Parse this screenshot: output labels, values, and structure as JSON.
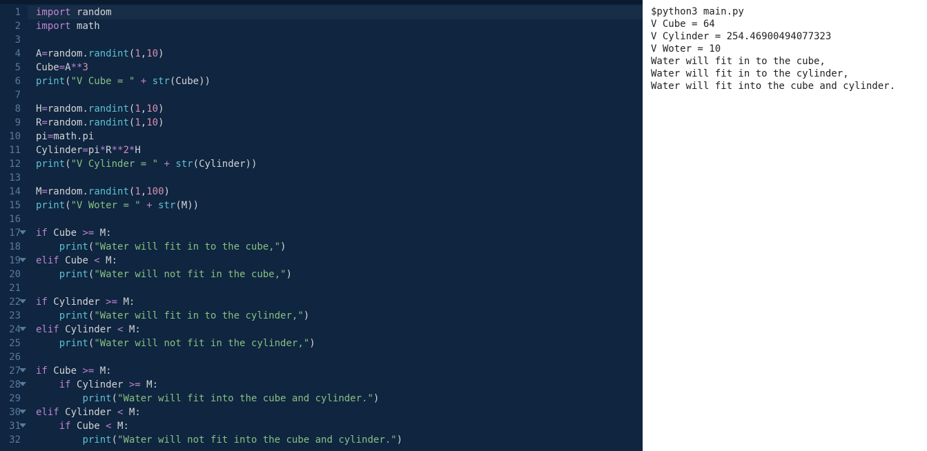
{
  "editor": {
    "lines": [
      {
        "n": 1,
        "fold": false,
        "tokens": [
          {
            "t": "import ",
            "c": "kw"
          },
          {
            "t": "random",
            "c": "name"
          }
        ]
      },
      {
        "n": 2,
        "fold": false,
        "tokens": [
          {
            "t": "import ",
            "c": "kw"
          },
          {
            "t": "math",
            "c": "name"
          }
        ]
      },
      {
        "n": 3,
        "fold": false,
        "tokens": []
      },
      {
        "n": 4,
        "fold": false,
        "tokens": [
          {
            "t": "A",
            "c": "name"
          },
          {
            "t": "=",
            "c": "op"
          },
          {
            "t": "random",
            "c": "name"
          },
          {
            "t": ".",
            "c": "punct"
          },
          {
            "t": "randint",
            "c": "func"
          },
          {
            "t": "(",
            "c": "punct"
          },
          {
            "t": "1",
            "c": "num"
          },
          {
            "t": ",",
            "c": "punct"
          },
          {
            "t": "10",
            "c": "num"
          },
          {
            "t": ")",
            "c": "punct"
          }
        ]
      },
      {
        "n": 5,
        "fold": false,
        "tokens": [
          {
            "t": "Cube",
            "c": "name"
          },
          {
            "t": "=",
            "c": "op"
          },
          {
            "t": "A",
            "c": "name"
          },
          {
            "t": "**",
            "c": "op"
          },
          {
            "t": "3",
            "c": "num"
          }
        ]
      },
      {
        "n": 6,
        "fold": false,
        "tokens": [
          {
            "t": "print",
            "c": "builtin"
          },
          {
            "t": "(",
            "c": "punct"
          },
          {
            "t": "\"V Cube = \"",
            "c": "str"
          },
          {
            "t": " + ",
            "c": "op"
          },
          {
            "t": "str",
            "c": "builtin"
          },
          {
            "t": "(",
            "c": "punct"
          },
          {
            "t": "Cube",
            "c": "name"
          },
          {
            "t": ")",
            "c": "punct"
          },
          {
            "t": ")",
            "c": "punct"
          }
        ]
      },
      {
        "n": 7,
        "fold": false,
        "tokens": []
      },
      {
        "n": 8,
        "fold": false,
        "tokens": [
          {
            "t": "H",
            "c": "name"
          },
          {
            "t": "=",
            "c": "op"
          },
          {
            "t": "random",
            "c": "name"
          },
          {
            "t": ".",
            "c": "punct"
          },
          {
            "t": "randint",
            "c": "func"
          },
          {
            "t": "(",
            "c": "punct"
          },
          {
            "t": "1",
            "c": "num"
          },
          {
            "t": ",",
            "c": "punct"
          },
          {
            "t": "10",
            "c": "num"
          },
          {
            "t": ")",
            "c": "punct"
          }
        ]
      },
      {
        "n": 9,
        "fold": false,
        "tokens": [
          {
            "t": "R",
            "c": "name"
          },
          {
            "t": "=",
            "c": "op"
          },
          {
            "t": "random",
            "c": "name"
          },
          {
            "t": ".",
            "c": "punct"
          },
          {
            "t": "randint",
            "c": "func"
          },
          {
            "t": "(",
            "c": "punct"
          },
          {
            "t": "1",
            "c": "num"
          },
          {
            "t": ",",
            "c": "punct"
          },
          {
            "t": "10",
            "c": "num"
          },
          {
            "t": ")",
            "c": "punct"
          }
        ]
      },
      {
        "n": 10,
        "fold": false,
        "tokens": [
          {
            "t": "pi",
            "c": "name"
          },
          {
            "t": "=",
            "c": "op"
          },
          {
            "t": "math",
            "c": "name"
          },
          {
            "t": ".",
            "c": "punct"
          },
          {
            "t": "pi",
            "c": "name"
          }
        ]
      },
      {
        "n": 11,
        "fold": false,
        "tokens": [
          {
            "t": "Cylinder",
            "c": "name"
          },
          {
            "t": "=",
            "c": "op"
          },
          {
            "t": "pi",
            "c": "name"
          },
          {
            "t": "*",
            "c": "op"
          },
          {
            "t": "R",
            "c": "name"
          },
          {
            "t": "**",
            "c": "op"
          },
          {
            "t": "2",
            "c": "num"
          },
          {
            "t": "*",
            "c": "op"
          },
          {
            "t": "H",
            "c": "name"
          }
        ]
      },
      {
        "n": 12,
        "fold": false,
        "tokens": [
          {
            "t": "print",
            "c": "builtin"
          },
          {
            "t": "(",
            "c": "punct"
          },
          {
            "t": "\"V Cylinder = \"",
            "c": "str"
          },
          {
            "t": " + ",
            "c": "op"
          },
          {
            "t": "str",
            "c": "builtin"
          },
          {
            "t": "(",
            "c": "punct"
          },
          {
            "t": "Cylinder",
            "c": "name"
          },
          {
            "t": ")",
            "c": "punct"
          },
          {
            "t": ")",
            "c": "punct"
          }
        ]
      },
      {
        "n": 13,
        "fold": false,
        "tokens": []
      },
      {
        "n": 14,
        "fold": false,
        "tokens": [
          {
            "t": "M",
            "c": "name"
          },
          {
            "t": "=",
            "c": "op"
          },
          {
            "t": "random",
            "c": "name"
          },
          {
            "t": ".",
            "c": "punct"
          },
          {
            "t": "randint",
            "c": "func"
          },
          {
            "t": "(",
            "c": "punct"
          },
          {
            "t": "1",
            "c": "num"
          },
          {
            "t": ",",
            "c": "punct"
          },
          {
            "t": "100",
            "c": "num"
          },
          {
            "t": ")",
            "c": "punct"
          }
        ]
      },
      {
        "n": 15,
        "fold": false,
        "tokens": [
          {
            "t": "print",
            "c": "builtin"
          },
          {
            "t": "(",
            "c": "punct"
          },
          {
            "t": "\"V Woter = \"",
            "c": "str"
          },
          {
            "t": " + ",
            "c": "op"
          },
          {
            "t": "str",
            "c": "builtin"
          },
          {
            "t": "(",
            "c": "punct"
          },
          {
            "t": "M",
            "c": "name"
          },
          {
            "t": ")",
            "c": "punct"
          },
          {
            "t": ")",
            "c": "punct"
          }
        ]
      },
      {
        "n": 16,
        "fold": false,
        "tokens": []
      },
      {
        "n": 17,
        "fold": true,
        "tokens": [
          {
            "t": "if ",
            "c": "kw"
          },
          {
            "t": "Cube",
            "c": "name"
          },
          {
            "t": " >= ",
            "c": "op"
          },
          {
            "t": "M",
            "c": "name"
          },
          {
            "t": ":",
            "c": "punct"
          }
        ]
      },
      {
        "n": 18,
        "fold": false,
        "indent": 1,
        "tokens": [
          {
            "t": "    ",
            "c": ""
          },
          {
            "t": "print",
            "c": "builtin"
          },
          {
            "t": "(",
            "c": "punct"
          },
          {
            "t": "\"Water will fit in to the cube,\"",
            "c": "str"
          },
          {
            "t": ")",
            "c": "punct"
          }
        ]
      },
      {
        "n": 19,
        "fold": true,
        "tokens": [
          {
            "t": "elif ",
            "c": "kw"
          },
          {
            "t": "Cube",
            "c": "name"
          },
          {
            "t": " < ",
            "c": "op"
          },
          {
            "t": "M",
            "c": "name"
          },
          {
            "t": ":",
            "c": "punct"
          }
        ]
      },
      {
        "n": 20,
        "fold": false,
        "indent": 1,
        "tokens": [
          {
            "t": "    ",
            "c": ""
          },
          {
            "t": "print",
            "c": "builtin"
          },
          {
            "t": "(",
            "c": "punct"
          },
          {
            "t": "\"Water will not fit in the cube,\"",
            "c": "str"
          },
          {
            "t": ")",
            "c": "punct"
          }
        ]
      },
      {
        "n": 21,
        "fold": false,
        "tokens": []
      },
      {
        "n": 22,
        "fold": true,
        "tokens": [
          {
            "t": "if ",
            "c": "kw"
          },
          {
            "t": "Cylinder",
            "c": "name"
          },
          {
            "t": " >= ",
            "c": "op"
          },
          {
            "t": "M",
            "c": "name"
          },
          {
            "t": ":",
            "c": "punct"
          }
        ]
      },
      {
        "n": 23,
        "fold": false,
        "indent": 1,
        "tokens": [
          {
            "t": "    ",
            "c": ""
          },
          {
            "t": "print",
            "c": "builtin"
          },
          {
            "t": "(",
            "c": "punct"
          },
          {
            "t": "\"Water will fit in to the cylinder,\"",
            "c": "str"
          },
          {
            "t": ")",
            "c": "punct"
          }
        ]
      },
      {
        "n": 24,
        "fold": true,
        "tokens": [
          {
            "t": "elif ",
            "c": "kw"
          },
          {
            "t": "Cylinder",
            "c": "name"
          },
          {
            "t": " < ",
            "c": "op"
          },
          {
            "t": "M",
            "c": "name"
          },
          {
            "t": ":",
            "c": "punct"
          }
        ]
      },
      {
        "n": 25,
        "fold": false,
        "indent": 1,
        "tokens": [
          {
            "t": "    ",
            "c": ""
          },
          {
            "t": "print",
            "c": "builtin"
          },
          {
            "t": "(",
            "c": "punct"
          },
          {
            "t": "\"Water will not fit in the cylinder,\"",
            "c": "str"
          },
          {
            "t": ")",
            "c": "punct"
          }
        ]
      },
      {
        "n": 26,
        "fold": false,
        "tokens": []
      },
      {
        "n": 27,
        "fold": true,
        "tokens": [
          {
            "t": "if ",
            "c": "kw"
          },
          {
            "t": "Cube",
            "c": "name"
          },
          {
            "t": " >= ",
            "c": "op"
          },
          {
            "t": "M",
            "c": "name"
          },
          {
            "t": ":",
            "c": "punct"
          }
        ]
      },
      {
        "n": 28,
        "fold": true,
        "indent": 1,
        "tokens": [
          {
            "t": "    ",
            "c": ""
          },
          {
            "t": "if ",
            "c": "kw"
          },
          {
            "t": "Cylinder",
            "c": "name"
          },
          {
            "t": " >= ",
            "c": "op"
          },
          {
            "t": "M",
            "c": "name"
          },
          {
            "t": ":",
            "c": "punct"
          }
        ]
      },
      {
        "n": 29,
        "fold": false,
        "indent": 2,
        "tokens": [
          {
            "t": "        ",
            "c": ""
          },
          {
            "t": "print",
            "c": "builtin"
          },
          {
            "t": "(",
            "c": "punct"
          },
          {
            "t": "\"Water will fit into the cube and cylinder.\"",
            "c": "str"
          },
          {
            "t": ")",
            "c": "punct"
          }
        ]
      },
      {
        "n": 30,
        "fold": true,
        "tokens": [
          {
            "t": "elif ",
            "c": "kw"
          },
          {
            "t": "Cylinder",
            "c": "name"
          },
          {
            "t": " < ",
            "c": "op"
          },
          {
            "t": "M",
            "c": "name"
          },
          {
            "t": ":",
            "c": "punct"
          }
        ]
      },
      {
        "n": 31,
        "fold": true,
        "indent": 1,
        "tokens": [
          {
            "t": "    ",
            "c": ""
          },
          {
            "t": "if ",
            "c": "kw"
          },
          {
            "t": "Cube",
            "c": "name"
          },
          {
            "t": " < ",
            "c": "op"
          },
          {
            "t": "M",
            "c": "name"
          },
          {
            "t": ":",
            "c": "punct"
          }
        ]
      },
      {
        "n": 32,
        "fold": false,
        "indent": 2,
        "tokens": [
          {
            "t": "        ",
            "c": ""
          },
          {
            "t": "print",
            "c": "builtin"
          },
          {
            "t": "(",
            "c": "punct"
          },
          {
            "t": "\"Water will not fit into the cube and cylinder.\"",
            "c": "str"
          },
          {
            "t": ")",
            "c": "punct"
          }
        ]
      }
    ],
    "highlight_line": 1
  },
  "output": {
    "command": "$python3 main.py",
    "lines": [
      "V Cube = 64",
      "V Cylinder = 254.46900494077323",
      "V Woter = 10",
      "Water will fit in to the cube,",
      "Water will fit in to the cylinder,",
      "Water will fit into the cube and cylinder."
    ]
  }
}
